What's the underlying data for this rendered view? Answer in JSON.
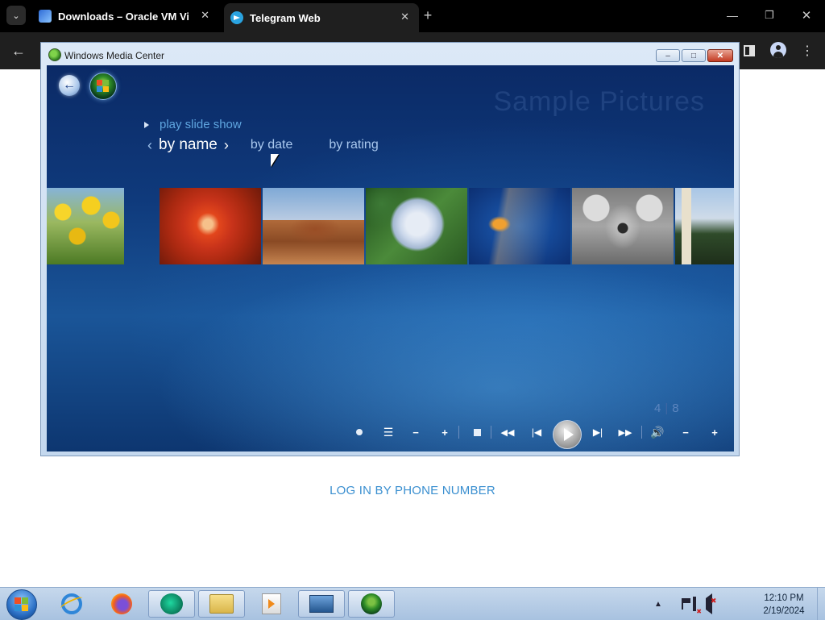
{
  "browser": {
    "tabs": [
      {
        "title": "Downloads – Oracle VM Virtua",
        "active": false
      },
      {
        "title": "Telegram Web",
        "active": true
      }
    ],
    "glyphs": {
      "close": "✕",
      "new_tab": "+",
      "minimize": "—",
      "restore": "❐",
      "back": "←",
      "menu": "⋮",
      "tab_search": "⌄"
    }
  },
  "page": {
    "login_link": "LOG IN BY PHONE NUMBER",
    "link_color": "#3a8fd0"
  },
  "wmc": {
    "window_title": "Windows Media Center",
    "title_buttons": {
      "minimize": "–",
      "maximize": "□",
      "close": "✕"
    },
    "gallery_title": "Sample Pictures",
    "play_slide_show": "play slide show",
    "sort": {
      "prev_glyph": "‹",
      "next_glyph": "›",
      "options": [
        "by name",
        "by date",
        "by rating"
      ],
      "selected": "by name"
    },
    "thumbnails": [
      "Tulips",
      "Chrysanthemum",
      "Desert",
      "Hydrangeas",
      "Jellyfish",
      "Koala",
      "Lighthouse"
    ],
    "counter": {
      "current": "4",
      "separator": "|",
      "total": "8"
    },
    "transport": {
      "guide": "☰",
      "ch_minus": "−",
      "ch_plus": "+",
      "rewind": "◀◀",
      "prev": "|◀",
      "next": "▶|",
      "ffwd": "▶▶",
      "mute": "🔊",
      "vol_minus": "−",
      "vol_plus": "+"
    },
    "back_glyph": "←",
    "accent_color": "#5fa6e0"
  },
  "taskbar": {
    "apps": [
      "Internet Explorer",
      "Firefox",
      "Windows Media Player",
      "Windows Explorer",
      "Media Player",
      "VirtualBox",
      "Windows Media Center"
    ],
    "active_app": "Windows Media Center",
    "tray": {
      "chevron": "▲"
    },
    "clock": {
      "time": "12:10 PM",
      "date": "2/19/2024"
    }
  }
}
